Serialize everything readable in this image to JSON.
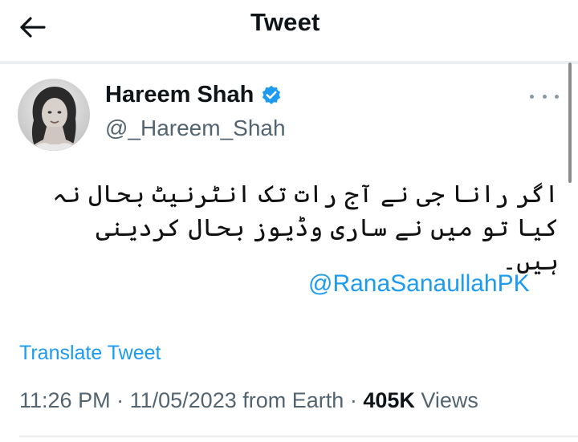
{
  "header": {
    "title": "Tweet",
    "back_icon": "arrow-left-icon"
  },
  "author": {
    "display_name": "Hareem Shah",
    "handle": "@_Hareem_Shah",
    "verified": true,
    "verified_color": "#1d9bf0"
  },
  "tweet": {
    "text": "اگر رانا جی نے آج رات تک انٹرنیٹ بحال نہ کیا تو میں نے ساری وڈیوز بحال کردینی ہیں۔",
    "mention": "@RanaSanaullahPK",
    "translate_label": "Translate Tweet"
  },
  "meta": {
    "time": "11:26 PM",
    "date": "11/05/2023",
    "source": "from Earth",
    "views_count": "405K",
    "views_label": "Views"
  },
  "colors": {
    "accent": "#1d9bf0",
    "secondary_text": "#536471",
    "primary_text": "#0f1419"
  }
}
